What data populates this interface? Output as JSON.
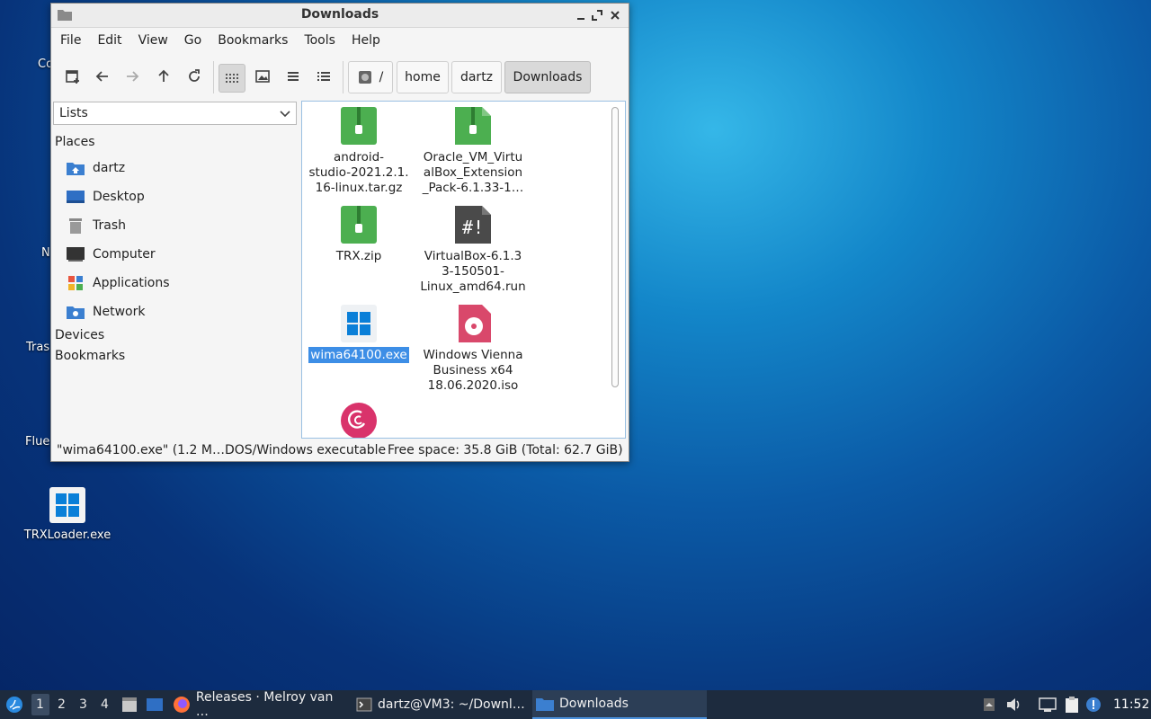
{
  "desktop": {
    "partial_labels": [
      "Co",
      "N",
      "Tras",
      "Flue"
    ],
    "icon_label": "TRXLoader.exe"
  },
  "window": {
    "title": "Downloads",
    "menu": [
      "File",
      "Edit",
      "View",
      "Go",
      "Bookmarks",
      "Tools",
      "Help"
    ],
    "path": [
      "/",
      "home",
      "dartz",
      "Downloads"
    ]
  },
  "sidebar": {
    "selector": "Lists",
    "places_heading": "Places",
    "places": [
      "dartz",
      "Desktop",
      "Trash",
      "Computer",
      "Applications",
      "Network"
    ],
    "devices_heading": "Devices",
    "bookmarks_heading": "Bookmarks"
  },
  "files": [
    {
      "name": "android-\nstudio-2021.2.1.\n16-linux.tar.gz",
      "icon": "archive-icon"
    },
    {
      "name": "Oracle_VM_Virtu\nalBox_Extension\n_Pack-6.1.33-1…",
      "icon": "archive-icon"
    },
    {
      "name": "TRX.zip",
      "icon": "archive-icon"
    },
    {
      "name": "VirtualBox-6.1.3\n3-150501-\nLinux_amd64.run",
      "icon": "script-icon"
    },
    {
      "name": "wima64100.exe",
      "icon": "windows-exe-icon",
      "selected": true
    },
    {
      "name": "Windows Vienna\nBusiness x64\n18.06.2020.iso",
      "icon": "disc-image-icon"
    },
    {
      "name": "",
      "icon": "debian-icon"
    }
  ],
  "status": {
    "selection": "\"wima64100.exe\" (1.2 M…DOS/Windows executable",
    "free_space": "Free space: 35.8 GiB (Total: 62.7 GiB)"
  },
  "taskbar": {
    "workspaces": [
      "1",
      "2",
      "3",
      "4"
    ],
    "tasks": [
      "Releases · Melroy van …",
      "dartz@VM3: ~/Downl…",
      "Downloads"
    ],
    "clock": "11:52"
  },
  "colors": {
    "accent": "#3d8ee6",
    "archive_green": "#4caf50",
    "taskbar_bg": "#1d2b3e"
  }
}
